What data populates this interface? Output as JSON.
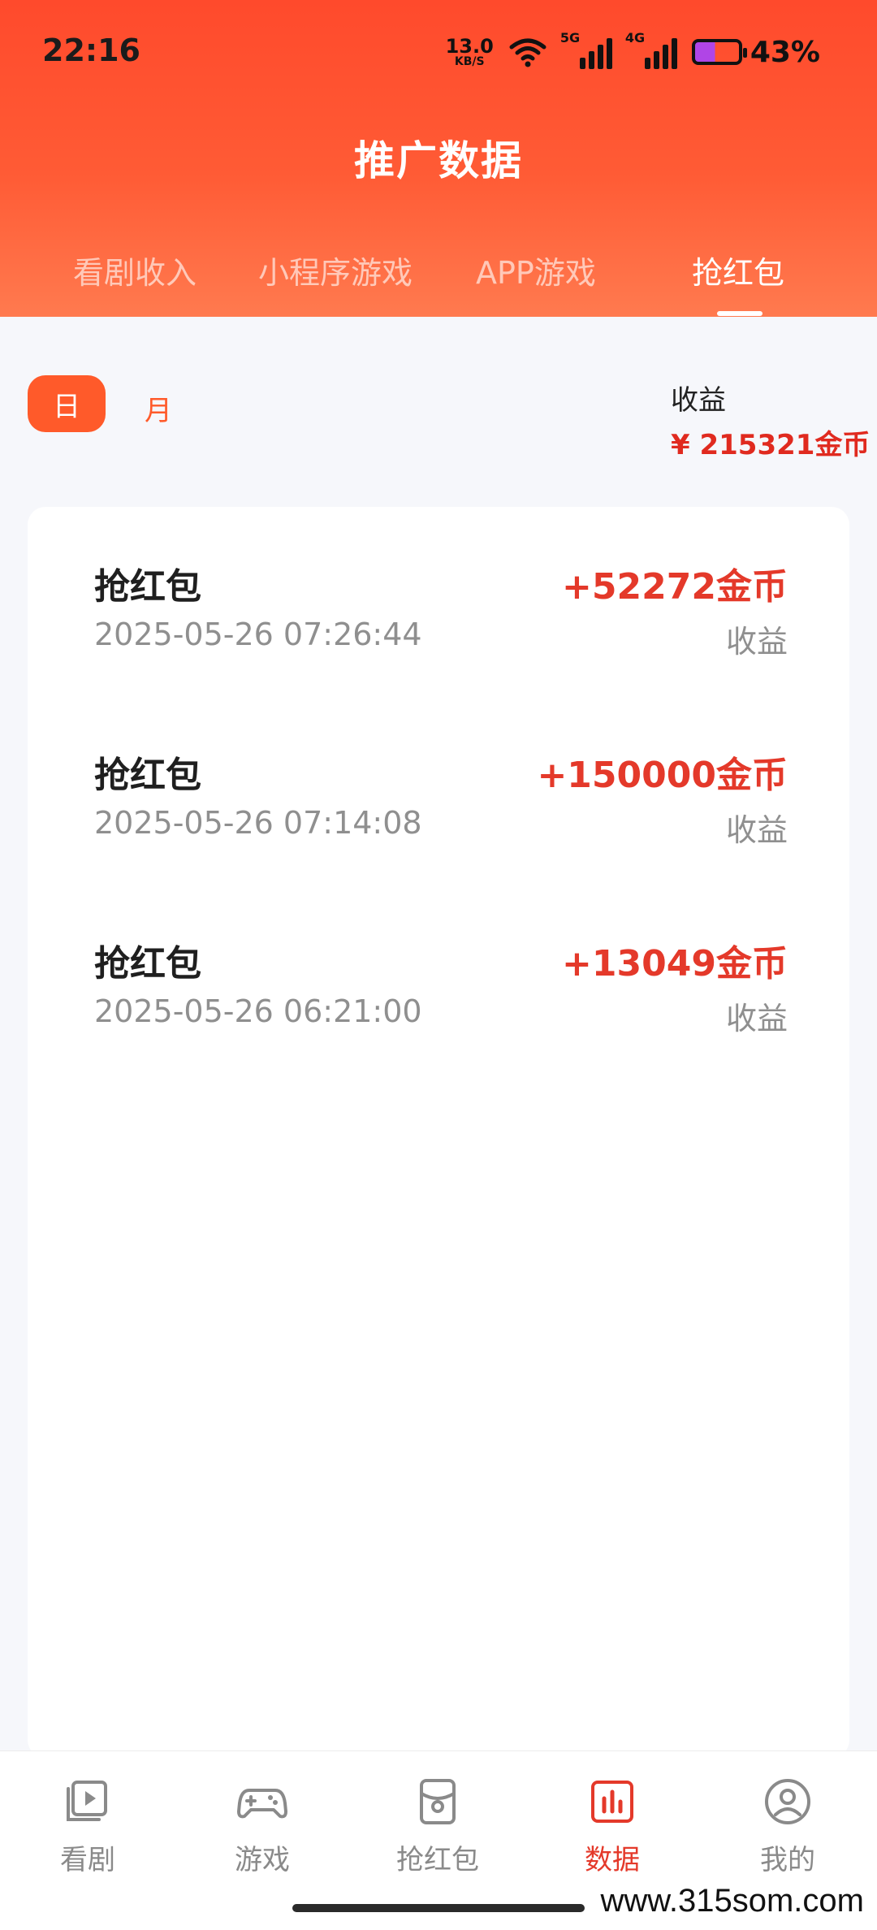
{
  "status_bar": {
    "time": "22:16",
    "net_speed_value": "13.0",
    "net_speed_unit": "KB/S",
    "signal1_label": "5G",
    "signal2_label": "4G",
    "battery": "43%"
  },
  "header": {
    "title": "推广数据",
    "tabs": [
      {
        "label": "看剧收入"
      },
      {
        "label": "小程序游戏"
      },
      {
        "label": "APP游戏"
      },
      {
        "label": "抢红包"
      }
    ]
  },
  "filter": {
    "day": "日",
    "month": "月"
  },
  "summary": {
    "label": "收益",
    "amount": "¥ 215321金币"
  },
  "records": [
    {
      "title": "抢红包",
      "time": "2025-05-26 07:26:44",
      "amount": "+52272金币",
      "label": "收益"
    },
    {
      "title": "抢红包",
      "time": "2025-05-26 07:14:08",
      "amount": "+150000金币",
      "label": "收益"
    },
    {
      "title": "抢红包",
      "time": "2025-05-26 06:21:00",
      "amount": "+13049金币",
      "label": "收益"
    }
  ],
  "bottom_nav": [
    {
      "label": "看剧",
      "icon": "play-library-icon"
    },
    {
      "label": "游戏",
      "icon": "gamepad-icon"
    },
    {
      "label": "抢红包",
      "icon": "red-packet-icon"
    },
    {
      "label": "数据",
      "icon": "bar-chart-icon"
    },
    {
      "label": "我的",
      "icon": "user-icon"
    }
  ],
  "watermark": "www.315som.com",
  "colors": {
    "accent": "#ff5a2a",
    "amount_red": "#e4392a"
  }
}
